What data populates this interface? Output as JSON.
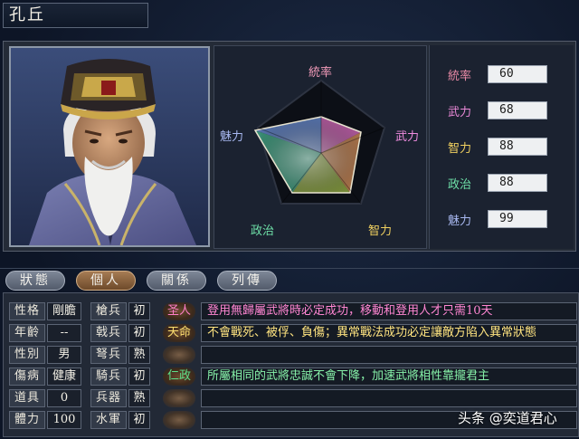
{
  "character": {
    "name": "孔丘"
  },
  "radar": {
    "labels": {
      "command": "統率",
      "force": "武力",
      "intellect": "智力",
      "politics": "政治",
      "charm": "魅力"
    }
  },
  "stats": [
    {
      "label": "統率",
      "value": "60",
      "color": "#e88aa6"
    },
    {
      "label": "武力",
      "value": "68",
      "color": "#e888d6"
    },
    {
      "label": "智力",
      "value": "88",
      "color": "#f0d060"
    },
    {
      "label": "政治",
      "value": "88",
      "color": "#6ee0a8"
    },
    {
      "label": "魅力",
      "value": "99",
      "color": "#a8b8f0"
    }
  ],
  "tabs": [
    {
      "label": "狀態",
      "active": false
    },
    {
      "label": "個人",
      "active": true
    },
    {
      "label": "關係",
      "active": false
    },
    {
      "label": "列傳",
      "active": false
    }
  ],
  "personal": [
    {
      "label": "性格",
      "value": "剛膽"
    },
    {
      "label": "年齡",
      "value": "--"
    },
    {
      "label": "性別",
      "value": "男"
    },
    {
      "label": "傷病",
      "value": "健康"
    },
    {
      "label": "道具",
      "value": "0"
    },
    {
      "label": "體力",
      "value": "100"
    }
  ],
  "troops": [
    {
      "label": "槍兵",
      "value": "初"
    },
    {
      "label": "戟兵",
      "value": "初"
    },
    {
      "label": "弩兵",
      "value": "熟"
    },
    {
      "label": "騎兵",
      "value": "初"
    },
    {
      "label": "兵器",
      "value": "熟"
    },
    {
      "label": "水軍",
      "value": "初"
    }
  ],
  "skills": [
    {
      "name": "圣人",
      "name_color": "#ff7ec8",
      "desc": "登用無歸屬武將時必定成功，移動和登用人才只需10天",
      "desc_color": "#ff86d2",
      "state": "on"
    },
    {
      "name": "天命",
      "name_color": "#ffe070",
      "desc": "不會戰死、被俘、負傷；異常戰法成功必定讓敵方陷入異常狀態",
      "desc_color": "#ffe480",
      "state": "on"
    },
    {
      "name": "",
      "name_color": "#ffffff",
      "desc": "",
      "desc_color": "#ffffff",
      "state": "off"
    },
    {
      "name": "仁政",
      "name_color": "#5ee08a",
      "desc": "所屬相同的武將忠誠不會下降，加速武將相性靠攏君主",
      "desc_color": "#86f0a8",
      "state": "on"
    },
    {
      "name": "",
      "name_color": "#ffffff",
      "desc": "",
      "desc_color": "#ffffff",
      "state": "off"
    },
    {
      "name": "",
      "name_color": "#ffffff",
      "desc": "",
      "desc_color": "#ffffff",
      "state": "off"
    }
  ],
  "watermark": "头条 @奕道君心"
}
